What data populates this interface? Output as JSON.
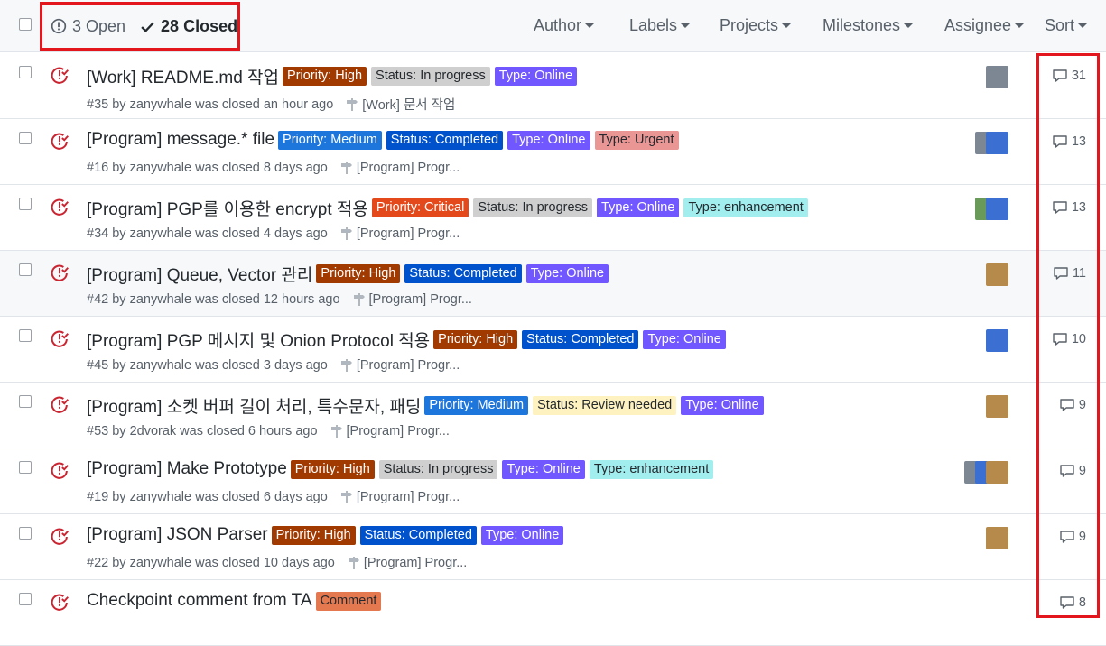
{
  "header": {
    "open_label": "3 Open",
    "closed_label": "28 Closed",
    "filters": [
      "Author",
      "Labels",
      "Projects",
      "Milestones",
      "Assignee",
      "Sort"
    ]
  },
  "colors": {
    "priority_high": "#b60205",
    "priority_medium": "#1d76db",
    "priority_critical": "#e4491b",
    "status_in_progress": "#cfcfcf",
    "status_completed": "#0052cc",
    "status_review": "#fef2c0",
    "type_online": "#7057ff",
    "type_urgent": "#e99695",
    "type_enhancement": "#a2eeef",
    "comment": "#e99695",
    "highlight": "#e3161e"
  },
  "issues": [
    {
      "title": "[Work] README.md 작업",
      "labels": [
        {
          "text": "Priority: High",
          "bg": "#a03a00",
          "fg": "#ffffff"
        },
        {
          "text": "Status: In progress",
          "bg": "#cfcfcf",
          "fg": "#24292e"
        },
        {
          "text": "Type: Online",
          "bg": "#7057ff",
          "fg": "#ffffff"
        }
      ],
      "meta": "#35 by zanywhale was closed an hour ago",
      "milestone": "[Work] 문서 작업",
      "comments": "31",
      "avatars": [
        "grey"
      ]
    },
    {
      "title": "[Program] message.* file",
      "labels": [
        {
          "text": "Priority: Medium",
          "bg": "#1d76db",
          "fg": "#ffffff"
        },
        {
          "text": "Status: Completed",
          "bg": "#0052cc",
          "fg": "#ffffff"
        },
        {
          "text": "Type: Online",
          "bg": "#7057ff",
          "fg": "#ffffff"
        },
        {
          "text": "Type: Urgent",
          "bg": "#e99695",
          "fg": "#24292e"
        }
      ],
      "meta": "#16 by zanywhale was closed 8 days ago",
      "milestone": "[Program] Progr...",
      "comments": "13",
      "avatars": [
        "grey",
        "blue"
      ]
    },
    {
      "title": "[Program] PGP를 이용한 encrypt 적용",
      "labels": [
        {
          "text": "Priority: Critical",
          "bg": "#e4491b",
          "fg": "#ffffff"
        },
        {
          "text": "Status: In progress",
          "bg": "#cfcfcf",
          "fg": "#24292e"
        },
        {
          "text": "Type: Online",
          "bg": "#7057ff",
          "fg": "#ffffff"
        },
        {
          "text": "Type: enhancement",
          "bg": "#a2eeef",
          "fg": "#24292e"
        }
      ],
      "meta": "#34 by zanywhale was closed 4 days ago",
      "milestone": "[Program] Progr...",
      "comments": "13",
      "avatars": [
        "green",
        "blue"
      ]
    },
    {
      "title": "[Program] Queue, Vector 관리",
      "labels": [
        {
          "text": "Priority: High",
          "bg": "#a03a00",
          "fg": "#ffffff"
        },
        {
          "text": "Status: Completed",
          "bg": "#0052cc",
          "fg": "#ffffff"
        },
        {
          "text": "Type: Online",
          "bg": "#7057ff",
          "fg": "#ffffff"
        }
      ],
      "meta": "#42 by zanywhale was closed 12 hours ago",
      "milestone": "[Program] Progr...",
      "comments": "11",
      "avatars": [
        "brown"
      ]
    },
    {
      "title": "[Program] PGP 메시지 및 Onion Protocol 적용",
      "labels": [
        {
          "text": "Priority: High",
          "bg": "#a03a00",
          "fg": "#ffffff"
        },
        {
          "text": "Status: Completed",
          "bg": "#0052cc",
          "fg": "#ffffff"
        },
        {
          "text": "Type: Online",
          "bg": "#7057ff",
          "fg": "#ffffff"
        }
      ],
      "meta": "#45 by zanywhale was closed 3 days ago",
      "milestone": "[Program] Progr...",
      "comments": "10",
      "avatars": [
        "blue"
      ]
    },
    {
      "title": "[Program] 소켓 버퍼 길이 처리, 특수문자, 패딩",
      "labels": [
        {
          "text": "Priority: Medium",
          "bg": "#1d76db",
          "fg": "#ffffff"
        },
        {
          "text": "Status: Review needed",
          "bg": "#fef2c0",
          "fg": "#24292e"
        },
        {
          "text": "Type: Online",
          "bg": "#7057ff",
          "fg": "#ffffff"
        }
      ],
      "meta": "#53 by 2dvorak was closed 6 hours ago",
      "milestone": "[Program] Progr...",
      "comments": "9",
      "avatars": [
        "brown"
      ]
    },
    {
      "title": "[Program] Make Prototype",
      "labels": [
        {
          "text": "Priority: High",
          "bg": "#a03a00",
          "fg": "#ffffff"
        },
        {
          "text": "Status: In progress",
          "bg": "#cfcfcf",
          "fg": "#24292e"
        },
        {
          "text": "Type: Online",
          "bg": "#7057ff",
          "fg": "#ffffff"
        },
        {
          "text": "Type: enhancement",
          "bg": "#a2eeef",
          "fg": "#24292e"
        }
      ],
      "meta": "#19 by zanywhale was closed 6 days ago",
      "milestone": "[Program] Progr...",
      "comments": "9",
      "avatars": [
        "grey",
        "blue",
        "brown"
      ]
    },
    {
      "title": "[Program] JSON Parser",
      "labels": [
        {
          "text": "Priority: High",
          "bg": "#a03a00",
          "fg": "#ffffff"
        },
        {
          "text": "Status: Completed",
          "bg": "#0052cc",
          "fg": "#ffffff"
        },
        {
          "text": "Type: Online",
          "bg": "#7057ff",
          "fg": "#ffffff"
        }
      ],
      "meta": "#22 by zanywhale was closed 10 days ago",
      "milestone": "[Program] Progr...",
      "comments": "9",
      "avatars": [
        "brown"
      ]
    },
    {
      "title": "Checkpoint comment from TA",
      "labels": [
        {
          "text": "Comment",
          "bg": "#e4784f",
          "fg": "#24292e"
        }
      ],
      "meta": "",
      "milestone": "",
      "comments": "8",
      "avatars": []
    }
  ]
}
